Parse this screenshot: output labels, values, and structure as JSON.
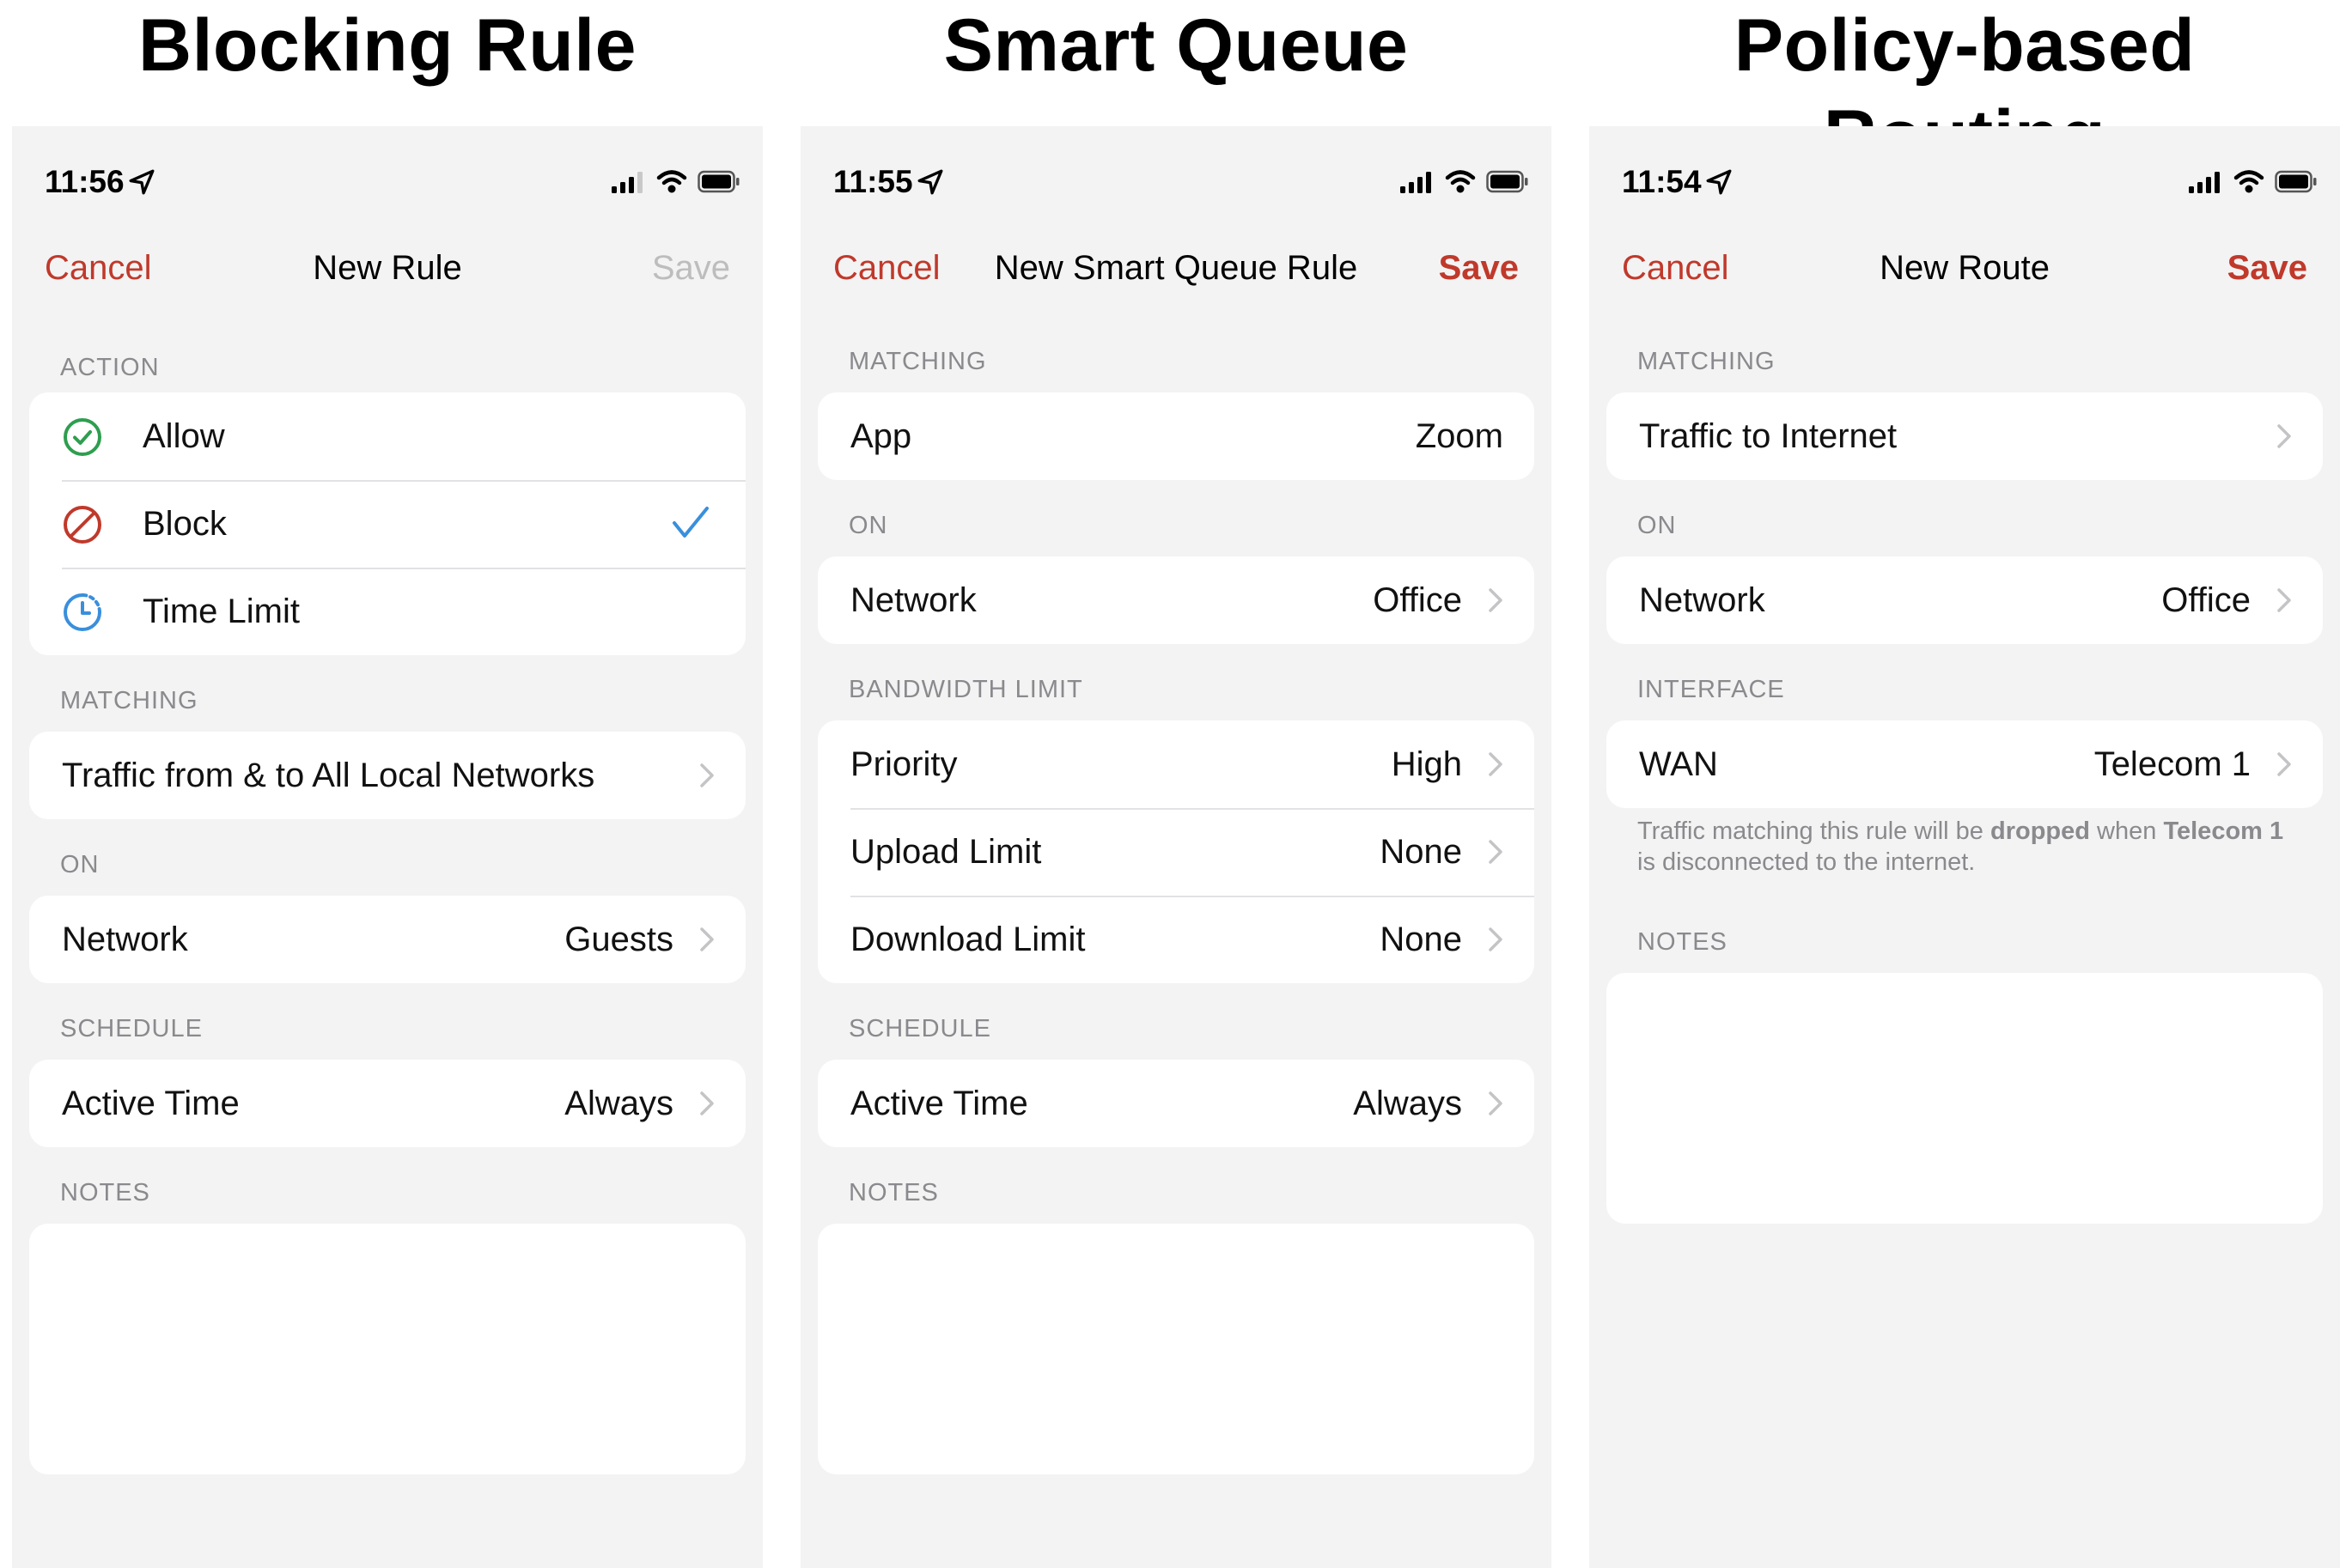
{
  "headings": [
    "Blocking Rule",
    "Smart Queue",
    "Policy-based Routing"
  ],
  "colors": {
    "accent": "#c0392b",
    "allow_green": "#2e9e4f",
    "block_red": "#c0392b",
    "time_blue": "#3a8fdc",
    "check_blue": "#3a8fdc"
  },
  "screens": [
    {
      "time": "11:56",
      "nav": {
        "cancel": "Cancel",
        "title": "New Rule",
        "save": "Save",
        "save_enabled": false
      },
      "action": {
        "label": "ACTION",
        "options": [
          {
            "label": "Allow",
            "icon": "check-circle-icon",
            "selected": false
          },
          {
            "label": "Block",
            "icon": "prohibited-icon",
            "selected": true
          },
          {
            "label": "Time Limit",
            "icon": "clock-icon",
            "selected": false
          }
        ]
      },
      "matching": {
        "label": "MATCHING",
        "value": "Traffic from & to All Local Networks"
      },
      "on": {
        "label": "ON",
        "key": "Network",
        "value": "Guests"
      },
      "schedule": {
        "label": "SCHEDULE",
        "key": "Active Time",
        "value": "Always"
      },
      "notes": {
        "label": "NOTES"
      }
    },
    {
      "time": "11:55",
      "nav": {
        "cancel": "Cancel",
        "title": "New Smart Queue Rule",
        "save": "Save",
        "save_enabled": true
      },
      "matching": {
        "label": "MATCHING",
        "key": "App",
        "value": "Zoom"
      },
      "on": {
        "label": "ON",
        "key": "Network",
        "value": "Office"
      },
      "bandwidth": {
        "label": "BANDWIDTH LIMIT",
        "rows": [
          {
            "key": "Priority",
            "value": "High"
          },
          {
            "key": "Upload Limit",
            "value": "None"
          },
          {
            "key": "Download Limit",
            "value": "None"
          }
        ]
      },
      "schedule": {
        "label": "SCHEDULE",
        "key": "Active Time",
        "value": "Always"
      },
      "notes": {
        "label": "NOTES"
      }
    },
    {
      "time": "11:54",
      "nav": {
        "cancel": "Cancel",
        "title": "New Route",
        "save": "Save",
        "save_enabled": true
      },
      "matching": {
        "label": "MATCHING",
        "value": "Traffic to Internet"
      },
      "on": {
        "label": "ON",
        "key": "Network",
        "value": "Office"
      },
      "interface": {
        "label": "INTERFACE",
        "key": "WAN",
        "value": "Telecom 1",
        "footnote_parts": [
          "Traffic matching this rule will be ",
          "dropped",
          " when ",
          "Telecom 1",
          " is disconnected to the internet."
        ]
      },
      "notes": {
        "label": "NOTES"
      }
    }
  ]
}
